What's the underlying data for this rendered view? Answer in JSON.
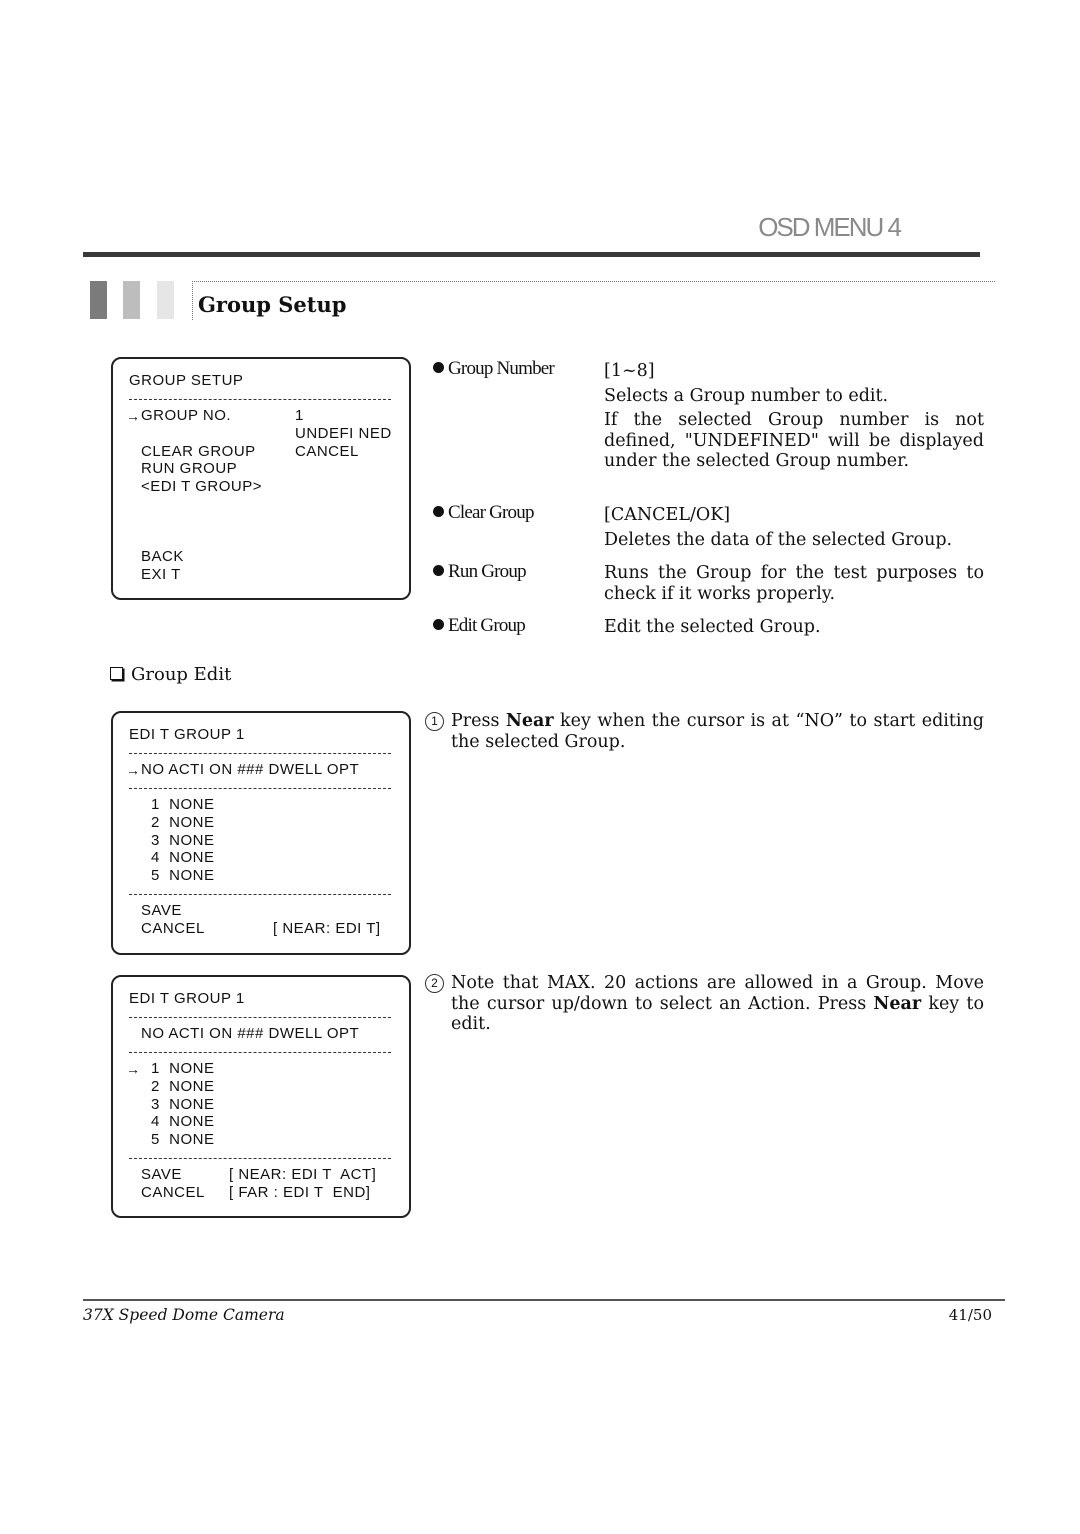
{
  "header": {
    "title": "OSD MENU 4"
  },
  "section": {
    "title": "Group Setup"
  },
  "setup_box": {
    "title": "GROUP SETUP",
    "cursor": "→",
    "rows": [
      {
        "label": "GROUP NO.",
        "value": "1"
      },
      {
        "label": "",
        "value": "UNDEFI NED"
      },
      {
        "label": "CLEAR GROUP",
        "value": "CANCEL"
      },
      {
        "label": "RUN GROUP",
        "value": ""
      },
      {
        "label": "<EDI T GROUP>",
        "value": ""
      }
    ],
    "back": "BACK",
    "exit": "EXI T"
  },
  "descriptions": [
    {
      "label": "Group Number",
      "lines": [
        "[1~8]",
        "Selects a Group number to edit.",
        "If the selected Group number is not defined, \"UNDEFINED\" will be displayed under the selected Group number."
      ]
    },
    {
      "label": "Clear Group",
      "lines": [
        "[CANCEL/OK]",
        "Deletes the data of the selected Group."
      ]
    },
    {
      "label": "Run Group",
      "lines": [
        "Runs the Group for the test purposes to check if it works properly."
      ]
    },
    {
      "label": "Edit Group",
      "lines": [
        "Edit the selected Group."
      ]
    }
  ],
  "group_edit": {
    "subtitle": "Group Edit",
    "edit_box_1": {
      "title": "EDI T GROUP 1",
      "cursor": "→",
      "header": "NO ACTI ON ### DWELL OPT",
      "rows": [
        "1  NONE",
        "2  NONE",
        "3  NONE",
        "4  NONE",
        "5  NONE"
      ],
      "save": "SAVE",
      "cancel": "CANCEL",
      "hint": "[ NEAR: EDI T]"
    },
    "edit_box_2": {
      "title": "EDI T GROUP 1",
      "cursor": "→",
      "header": "NO ACTI ON ### DWELL OPT",
      "rows": [
        "1  NONE",
        "2  NONE",
        "3  NONE",
        "4  NONE",
        "5  NONE"
      ],
      "save": "SAVE",
      "cancel": "CANCEL",
      "hint_save": "[ NEAR: EDI T  ACT]",
      "hint_cancel": "[ FAR : EDI T  END]"
    },
    "steps": [
      {
        "num": "1",
        "pre": "Press ",
        "bold": "Near",
        "post": " key when the cursor is at “NO” to start editing the selected Group."
      },
      {
        "num": "2",
        "pre": "Note that MAX. 20 actions are allowed in a Group. Move the cursor up/down to select an Action. Press ",
        "bold": "Near",
        "post": " key to edit."
      }
    ]
  },
  "footer": {
    "left": "37X Speed Dome Camera",
    "page": "41/50"
  }
}
